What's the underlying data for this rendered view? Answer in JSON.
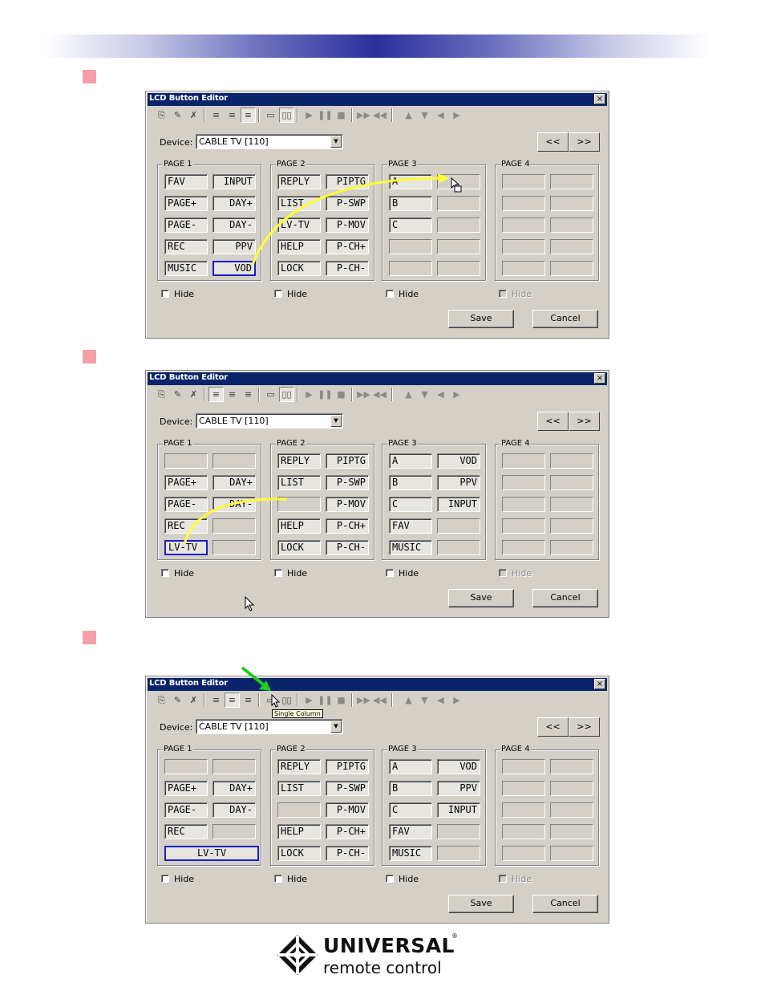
{
  "colors": {
    "banner_center": "#2a2f9a",
    "step_marker": "#f4a0a5",
    "dialog_face": "#d4d0c8",
    "titlebar": "#0a246a",
    "selected_border": "#1c1cc8",
    "arrow_yellow": "#ffff33",
    "pointer_green": "#22cc22"
  },
  "dialogs": [
    {
      "title": "LCD Button Editor",
      "close_glyph": "×",
      "device_label": "Device:",
      "device_value": "CABLE TV [110]",
      "nav_prev": "<<",
      "nav_next": ">>",
      "pages": [
        {
          "legend": "PAGE 1",
          "buttons": [
            {
              "text": "FAV",
              "align": "left",
              "filled": true
            },
            {
              "text": "INPUT",
              "align": "right",
              "filled": true
            },
            {
              "text": "PAGE+",
              "align": "left",
              "filled": true
            },
            {
              "text": "DAY+",
              "align": "right",
              "filled": true
            },
            {
              "text": "PAGE-",
              "align": "left",
              "filled": true
            },
            {
              "text": "DAY-",
              "align": "right",
              "filled": true
            },
            {
              "text": "REC",
              "align": "left",
              "filled": true
            },
            {
              "text": "PPV",
              "align": "right",
              "filled": true
            },
            {
              "text": "MUSIC",
              "align": "left",
              "filled": true
            },
            {
              "text": "VOD",
              "align": "right",
              "filled": true,
              "selected": true
            }
          ]
        },
        {
          "legend": "PAGE 2",
          "buttons": [
            {
              "text": "REPLY",
              "align": "left",
              "filled": true
            },
            {
              "text": "PIPTG",
              "align": "right",
              "filled": true
            },
            {
              "text": "LIST",
              "align": "left",
              "filled": true
            },
            {
              "text": "P-SWP",
              "align": "right",
              "filled": true
            },
            {
              "text": "LV-TV",
              "align": "left",
              "filled": true
            },
            {
              "text": "P-MOV",
              "align": "right",
              "filled": true
            },
            {
              "text": "HELP",
              "align": "left",
              "filled": true
            },
            {
              "text": "P-CH+",
              "align": "right",
              "filled": true
            },
            {
              "text": "LOCK",
              "align": "left",
              "filled": true
            },
            {
              "text": "P-CH-",
              "align": "right",
              "filled": true
            }
          ]
        },
        {
          "legend": "PAGE 3",
          "buttons": [
            {
              "text": "A",
              "align": "left",
              "filled": true
            },
            {
              "text": "",
              "filled": false
            },
            {
              "text": "B",
              "align": "left",
              "filled": true
            },
            {
              "text": "",
              "filled": false
            },
            {
              "text": "C",
              "align": "left",
              "filled": true
            },
            {
              "text": "",
              "filled": false
            },
            {
              "text": "",
              "filled": false
            },
            {
              "text": "",
              "filled": false
            },
            {
              "text": "",
              "filled": false
            },
            {
              "text": "",
              "filled": false
            }
          ]
        },
        {
          "legend": "PAGE 4",
          "buttons": [
            {
              "text": "",
              "filled": false
            },
            {
              "text": "",
              "filled": false
            },
            {
              "text": "",
              "filled": false
            },
            {
              "text": "",
              "filled": false
            },
            {
              "text": "",
              "filled": false
            },
            {
              "text": "",
              "filled": false
            },
            {
              "text": "",
              "filled": false
            },
            {
              "text": "",
              "filled": false
            },
            {
              "text": "",
              "filled": false
            },
            {
              "text": "",
              "filled": false
            }
          ]
        }
      ],
      "hide_label": "Hide",
      "save_label": "Save",
      "cancel_label": "Cancel"
    },
    {
      "title": "LCD Button Editor",
      "close_glyph": "×",
      "device_label": "Device:",
      "device_value": "CABLE TV [110]",
      "nav_prev": "<<",
      "nav_next": ">>",
      "pages": [
        {
          "legend": "PAGE 1",
          "buttons": [
            {
              "text": "",
              "filled": false
            },
            {
              "text": "",
              "filled": false
            },
            {
              "text": "PAGE+",
              "align": "left",
              "filled": true
            },
            {
              "text": "DAY+",
              "align": "right",
              "filled": true
            },
            {
              "text": "PAGE-",
              "align": "left",
              "filled": true
            },
            {
              "text": "DAY-",
              "align": "right",
              "filled": true
            },
            {
              "text": "REC",
              "align": "left",
              "filled": true
            },
            {
              "text": "",
              "filled": false
            },
            {
              "text": "LV-TV",
              "align": "left",
              "filled": true,
              "selected": true
            },
            {
              "text": "",
              "filled": false
            }
          ]
        },
        {
          "legend": "PAGE 2",
          "buttons": [
            {
              "text": "REPLY",
              "align": "left",
              "filled": true
            },
            {
              "text": "PIPTG",
              "align": "right",
              "filled": true
            },
            {
              "text": "LIST",
              "align": "left",
              "filled": true
            },
            {
              "text": "P-SWP",
              "align": "right",
              "filled": true
            },
            {
              "text": "",
              "filled": false
            },
            {
              "text": "P-MOV",
              "align": "right",
              "filled": true
            },
            {
              "text": "HELP",
              "align": "left",
              "filled": true
            },
            {
              "text": "P-CH+",
              "align": "right",
              "filled": true
            },
            {
              "text": "LOCK",
              "align": "left",
              "filled": true
            },
            {
              "text": "P-CH-",
              "align": "right",
              "filled": true
            }
          ]
        },
        {
          "legend": "PAGE 3",
          "buttons": [
            {
              "text": "A",
              "align": "left",
              "filled": true
            },
            {
              "text": "VOD",
              "align": "right",
              "filled": true
            },
            {
              "text": "B",
              "align": "left",
              "filled": true
            },
            {
              "text": "PPV",
              "align": "right",
              "filled": true
            },
            {
              "text": "C",
              "align": "left",
              "filled": true
            },
            {
              "text": "INPUT",
              "align": "right",
              "filled": true
            },
            {
              "text": "FAV",
              "align": "left",
              "filled": true
            },
            {
              "text": "",
              "filled": false
            },
            {
              "text": "MUSIC",
              "align": "left",
              "filled": true
            },
            {
              "text": "",
              "filled": false
            }
          ]
        },
        {
          "legend": "PAGE 4",
          "buttons": [
            {
              "text": "",
              "filled": false
            },
            {
              "text": "",
              "filled": false
            },
            {
              "text": "",
              "filled": false
            },
            {
              "text": "",
              "filled": false
            },
            {
              "text": "",
              "filled": false
            },
            {
              "text": "",
              "filled": false
            },
            {
              "text": "",
              "filled": false
            },
            {
              "text": "",
              "filled": false
            },
            {
              "text": "",
              "filled": false
            },
            {
              "text": "",
              "filled": false
            }
          ]
        }
      ],
      "hide_label": "Hide",
      "save_label": "Save",
      "cancel_label": "Cancel"
    },
    {
      "title": "LCD Button Editor",
      "close_glyph": "×",
      "device_label": "Device:",
      "device_value": "CABLE TV [110]",
      "nav_prev": "<<",
      "nav_next": ">>",
      "tooltip": "Single Column",
      "pages": [
        {
          "legend": "PAGE 1",
          "buttons": [
            {
              "text": "",
              "filled": false
            },
            {
              "text": "",
              "filled": false
            },
            {
              "text": "PAGE+",
              "align": "left",
              "filled": true
            },
            {
              "text": "DAY+",
              "align": "right",
              "filled": true
            },
            {
              "text": "PAGE-",
              "align": "left",
              "filled": true
            },
            {
              "text": "DAY-",
              "align": "right",
              "filled": true
            },
            {
              "text": "REC",
              "align": "left",
              "filled": true
            },
            {
              "text": "",
              "filled": false
            },
            {
              "text": "LV-TV",
              "align": "center",
              "filled": true,
              "selected": true,
              "wide": true
            }
          ]
        },
        {
          "legend": "PAGE 2",
          "buttons": [
            {
              "text": "REPLY",
              "align": "left",
              "filled": true
            },
            {
              "text": "PIPTG",
              "align": "right",
              "filled": true
            },
            {
              "text": "LIST",
              "align": "left",
              "filled": true
            },
            {
              "text": "P-SWP",
              "align": "right",
              "filled": true
            },
            {
              "text": "",
              "filled": false
            },
            {
              "text": "P-MOV",
              "align": "right",
              "filled": true
            },
            {
              "text": "HELP",
              "align": "left",
              "filled": true
            },
            {
              "text": "P-CH+",
              "align": "right",
              "filled": true
            },
            {
              "text": "LOCK",
              "align": "left",
              "filled": true
            },
            {
              "text": "P-CH-",
              "align": "right",
              "filled": true
            }
          ]
        },
        {
          "legend": "PAGE 3",
          "buttons": [
            {
              "text": "A",
              "align": "left",
              "filled": true
            },
            {
              "text": "VOD",
              "align": "right",
              "filled": true
            },
            {
              "text": "B",
              "align": "left",
              "filled": true
            },
            {
              "text": "PPV",
              "align": "right",
              "filled": true
            },
            {
              "text": "C",
              "align": "left",
              "filled": true
            },
            {
              "text": "INPUT",
              "align": "right",
              "filled": true
            },
            {
              "text": "FAV",
              "align": "left",
              "filled": true
            },
            {
              "text": "",
              "filled": false
            },
            {
              "text": "MUSIC",
              "align": "left",
              "filled": true
            },
            {
              "text": "",
              "filled": false
            }
          ]
        },
        {
          "legend": "PAGE 4",
          "buttons": [
            {
              "text": "",
              "filled": false
            },
            {
              "text": "",
              "filled": false
            },
            {
              "text": "",
              "filled": false
            },
            {
              "text": "",
              "filled": false
            },
            {
              "text": "",
              "filled": false
            },
            {
              "text": "",
              "filled": false
            },
            {
              "text": "",
              "filled": false
            },
            {
              "text": "",
              "filled": false
            },
            {
              "text": "",
              "filled": false
            },
            {
              "text": "",
              "filled": false
            }
          ]
        }
      ],
      "hide_label": "Hide",
      "save_label": "Save",
      "cancel_label": "Cancel"
    }
  ],
  "toolbar_icons": [
    "copy-icon",
    "edit-icon",
    "delete-icon",
    "align-left-icon",
    "align-center-icon",
    "align-right-icon",
    "single-column-icon",
    "double-column-icon",
    "play-icon",
    "pause-icon",
    "stop-icon",
    "fast-forward-icon",
    "rewind-icon",
    "up-arrow-icon",
    "down-arrow-icon",
    "left-arrow-icon",
    "right-arrow-icon"
  ],
  "logo": {
    "name": "UNIVERSAL",
    "registered": "®",
    "subtitle": "remote control"
  }
}
